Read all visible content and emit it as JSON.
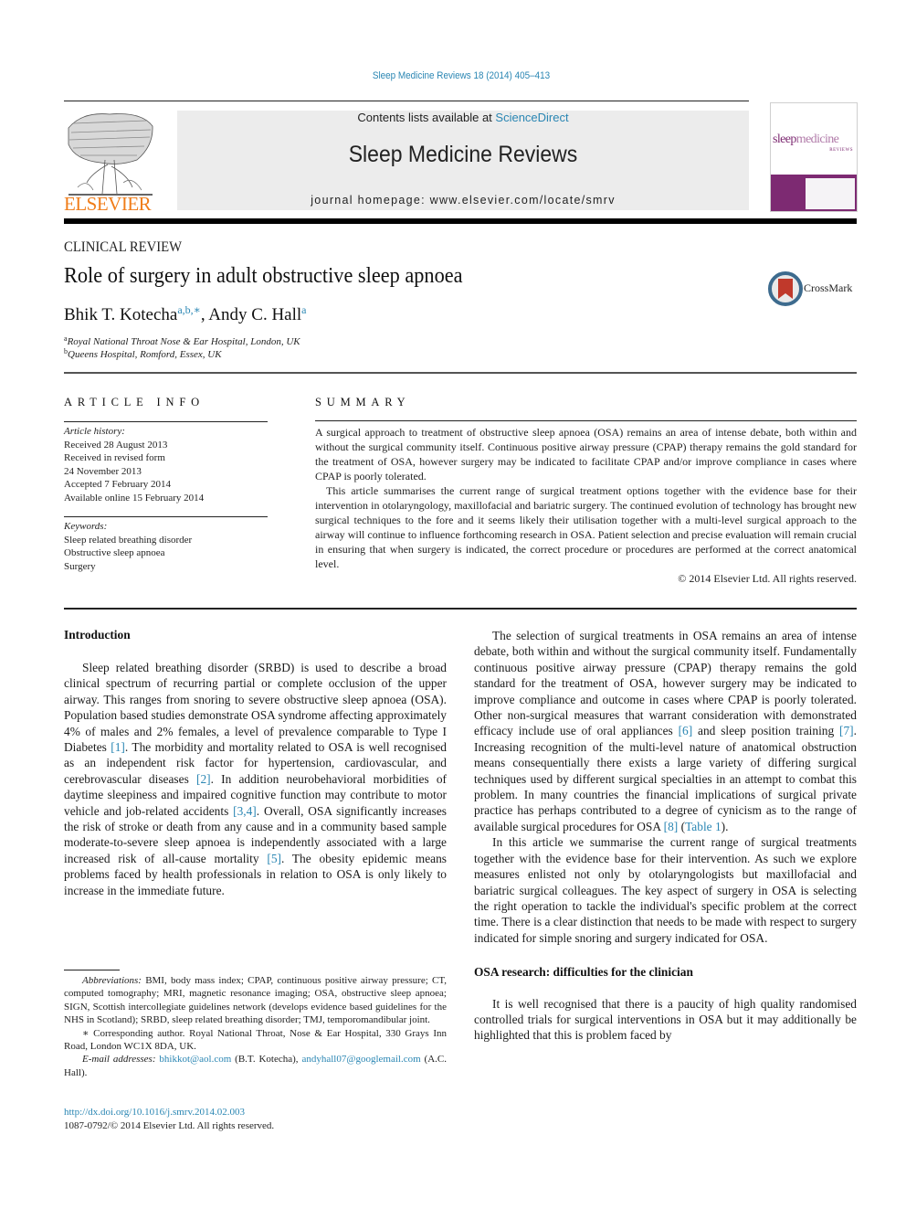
{
  "header": {
    "citation": "Sleep Medicine Reviews 18 (2014) 405–413",
    "contents_prefix": "Contents lists available at ",
    "contents_link": "ScienceDirect",
    "journal_title": "Sleep Medicine Reviews",
    "homepage": "journal homepage: www.elsevier.com/locate/smrv",
    "publisher_logo": "ELSEVIER",
    "cover": {
      "name_bold": "sleep",
      "name_light": "medicine",
      "subtitle": "REVIEWS",
      "color": "#7d2a72"
    },
    "crossmark_label": "CrossMark"
  },
  "article": {
    "section_type": "CLINICAL REVIEW",
    "title": "Role of surgery in adult obstructive sleep apnoea",
    "authors": [
      {
        "name": "Bhik T. Kotecha",
        "marks": "a,b,∗"
      },
      {
        "name": "Andy C. Hall",
        "marks": "a"
      }
    ],
    "author_separator": ", ",
    "affiliations": [
      {
        "mark": "a",
        "text": "Royal National Throat Nose & Ear Hospital, London, UK"
      },
      {
        "mark": "b",
        "text": "Queens Hospital, Romford, Essex, UK"
      }
    ]
  },
  "article_info": {
    "heading": "ARTICLE INFO",
    "history_label": "Article history:",
    "history": [
      "Received 28 August 2013",
      "Received in revised form",
      "24 November 2013",
      "Accepted 7 February 2014",
      "Available online 15 February 2014"
    ],
    "keywords_label": "Keywords:",
    "keywords": [
      "Sleep related breathing disorder",
      "Obstructive sleep apnoea",
      "Surgery"
    ]
  },
  "summary": {
    "heading": "SUMMARY",
    "paragraphs": [
      "A surgical approach to treatment of obstructive sleep apnoea (OSA) remains an area of intense debate, both within and without the surgical community itself. Continuous positive airway pressure (CPAP) therapy remains the gold standard for the treatment of OSA, however surgery may be indicated to facilitate CPAP and/or improve compliance in cases where CPAP is poorly tolerated.",
      "This article summarises the current range of surgical treatment options together with the evidence base for their intervention in otolaryngology, maxillofacial and bariatric surgery. The continued evolution of technology has brought new surgical techniques to the fore and it seems likely their utilisation together with a multi-level surgical approach to the airway will continue to influence forthcoming research in OSA. Patient selection and precise evaluation will remain crucial in ensuring that when surgery is indicated, the correct procedure or procedures are performed at the correct anatomical level."
    ],
    "copyright": "© 2014 Elsevier Ltd. All rights reserved."
  },
  "body": {
    "intro_heading": "Introduction",
    "intro": [
      {
        "t": "Sleep related breathing disorder (SRBD) is used to describe a broad clinical spectrum of recurring partial or complete occlusion of the upper airway. This ranges from snoring to severe obstructive sleep apnoea (OSA). Population based studies demonstrate OSA syndrome affecting approximately 4% of males and 2% females, a level of prevalence comparable to Type I Diabetes "
      },
      {
        "r": "[1]"
      },
      {
        "t": ". The morbidity and mortality related to OSA is well recognised as an independent risk factor for hypertension, cardiovascular, and cerebrovascular diseases "
      },
      {
        "r": "[2]"
      },
      {
        "t": ". In addition neurobehavioral morbidities of daytime sleepiness and impaired cognitive function may contribute to motor vehicle and job-related accidents "
      },
      {
        "r": "[3,4]"
      },
      {
        "t": ". Overall, OSA significantly increases the risk of stroke or death from any cause and in a community based sample moderate-to-severe sleep apnoea is independently associated with a large increased risk of all-cause mortality "
      },
      {
        "r": "[5]"
      },
      {
        "t": ". The obesity epidemic means problems faced by health professionals in relation to OSA is only likely to increase in the immediate future."
      }
    ],
    "right_p1": [
      {
        "t": "The selection of surgical treatments in OSA remains an area of intense debate, both within and without the surgical community itself. Fundamentally continuous positive airway pressure (CPAP) therapy remains the gold standard for the treatment of OSA, however surgery may be indicated to improve compliance and outcome in cases where CPAP is poorly tolerated. Other non-surgical measures that warrant consideration with demonstrated efficacy include use of oral appliances "
      },
      {
        "r": "[6]"
      },
      {
        "t": " and sleep position training "
      },
      {
        "r": "[7]"
      },
      {
        "t": ". Increasing recognition of the multi-level nature of anatomical obstruction means consequentially there exists a large variety of differing surgical techniques used by different surgical specialties in an attempt to combat this problem. In many countries the financial implications of surgical private practice has perhaps contributed to a degree of cynicism as to the range of available surgical procedures for OSA "
      },
      {
        "r": "[8]"
      },
      {
        "t": " ("
      },
      {
        "r": "Table 1"
      },
      {
        "t": ")."
      }
    ],
    "right_p2": "In this article we summarise the current range of surgical treatments together with the evidence base for their intervention. As such we explore measures enlisted not only by otolaryngologists but maxillofacial and bariatric surgical colleagues. The key aspect of surgery in OSA is selecting the right operation to tackle the individual's specific problem at the correct time. There is a clear distinction that needs to be made with respect to surgery indicated for simple snoring and surgery indicated for OSA.",
    "research_heading": "OSA research: difficulties for the clinician",
    "right_p3": "It is well recognised that there is a paucity of high quality randomised controlled trials for surgical interventions in OSA but it may additionally be highlighted that this is problem faced by"
  },
  "footnotes": {
    "abbreviations_label": "Abbreviations:",
    "abbreviations": " BMI, body mass index; CPAP, continuous positive airway pressure; CT, computed tomography; MRI, magnetic resonance imaging; OSA, obstructive sleep apnoea; SIGN, Scottish intercollegiate guidelines network (develops evidence based guidelines for the NHS in Scotland); SRBD, sleep related breathing disorder; TMJ, temporomandibular joint.",
    "corresponding": "∗ Corresponding author. Royal National Throat, Nose & Ear Hospital, 330 Grays Inn Road, London WC1X 8DA, UK.",
    "email_label": "E-mail addresses:",
    "email1": "bhikkot@aol.com",
    "email1_owner": " (B.T. Kotecha), ",
    "email2": "andyhall07@googlemail.com",
    "email2_owner": " (A.C. Hall)."
  },
  "footer": {
    "doi": "http://dx.doi.org/10.1016/j.smrv.2014.02.003",
    "issn": "1087-0792/© 2014 Elsevier Ltd. All rights reserved."
  }
}
